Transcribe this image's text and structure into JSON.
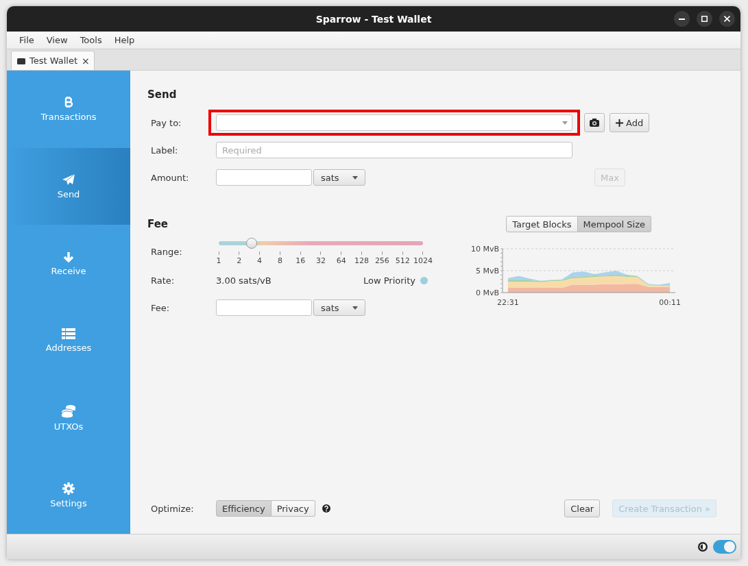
{
  "window": {
    "title": "Sparrow - Test Wallet"
  },
  "menu": [
    "File",
    "View",
    "Tools",
    "Help"
  ],
  "tabs": [
    {
      "label": "Test Wallet",
      "close": "×",
      "selected": true
    }
  ],
  "sidebar": {
    "items": [
      {
        "label": "Transactions",
        "kind": "bitcoin",
        "selected": false
      },
      {
        "label": "Send",
        "kind": "send",
        "selected": true
      },
      {
        "label": "Receive",
        "kind": "receive",
        "selected": false
      },
      {
        "label": "Addresses",
        "kind": "addresses",
        "selected": false
      },
      {
        "label": "UTXOs",
        "kind": "utxos",
        "selected": false
      },
      {
        "label": "Settings",
        "kind": "settings",
        "selected": false
      }
    ]
  },
  "send": {
    "title": "Send",
    "pay_to": {
      "label": "Pay to:",
      "highlighted": true
    },
    "add_button": "Add",
    "label_field": {
      "label": "Label:",
      "placeholder": "Required"
    },
    "amount": {
      "label": "Amount:",
      "unit": "sats"
    },
    "max_button": {
      "label": "Max",
      "disabled": true
    }
  },
  "fee": {
    "title": "Fee",
    "modes": [
      {
        "label": "Target Blocks",
        "selected": false
      },
      {
        "label": "Mempool Size",
        "selected": true
      }
    ],
    "range": {
      "label": "Range:",
      "level": 0.16,
      "ticks": [
        "1",
        "2",
        "4",
        "8",
        "16",
        "32",
        "64",
        "128",
        "256",
        "512",
        "1024"
      ]
    },
    "rate": {
      "label": "Rate:",
      "value": "3.00 sats/vB",
      "priority": "Low Priority",
      "color": "#9fcfdf"
    },
    "fee_field": {
      "label": "Fee:",
      "unit": "sats"
    },
    "chart_data": {
      "type": "area",
      "stacked": true,
      "categories": [
        "22:31",
        null,
        null,
        null,
        null,
        null,
        null,
        null,
        null,
        null,
        null,
        null,
        null,
        null,
        null,
        "00:11"
      ],
      "ylim": [
        0,
        10
      ],
      "yticks": [
        {
          "value": 0,
          "label": "0 MvB"
        },
        {
          "value": 5,
          "label": "5 MvB"
        },
        {
          "value": 10,
          "label": "10 MvB"
        }
      ],
      "series": [
        {
          "color": "#f2b8a2",
          "values": [
            1.1,
            1.1,
            1.1,
            1.1,
            1.1,
            1.1,
            1.8,
            1.8,
            1.8,
            1.9,
            1.9,
            2.0,
            2.0,
            1.3,
            1.3,
            1.3
          ]
        },
        {
          "color": "#f7dcaa",
          "values": [
            1.4,
            1.4,
            1.4,
            1.3,
            1.5,
            1.6,
            1.5,
            1.6,
            1.8,
            1.8,
            1.9,
            1.6,
            1.5,
            0.4,
            0.3,
            0.2
          ]
        },
        {
          "color": "#a6d39a",
          "values": [
            0.3,
            0.3,
            0.3,
            0.2,
            0.2,
            0.2,
            0.3,
            0.3,
            0.3,
            0.3,
            0.3,
            0.3,
            0.2,
            0.1,
            0.1,
            0.1
          ]
        },
        {
          "color": "#a9d3ee",
          "values": [
            0.5,
            1.0,
            0.4,
            0.1,
            0.1,
            0.1,
            1.0,
            1.1,
            0.3,
            0.6,
            0.9,
            0.2,
            0.1,
            0.2,
            0.1,
            0.6
          ]
        }
      ]
    }
  },
  "optimize": {
    "label": "Optimize:",
    "options": [
      {
        "label": "Efficiency",
        "selected": true
      },
      {
        "label": "Privacy",
        "selected": false
      }
    ]
  },
  "actions": [
    {
      "label": "Clear",
      "disabled": false
    },
    {
      "label": "Create Transaction »",
      "disabled": true
    }
  ],
  "status_bar": {
    "toggle_on": true
  }
}
